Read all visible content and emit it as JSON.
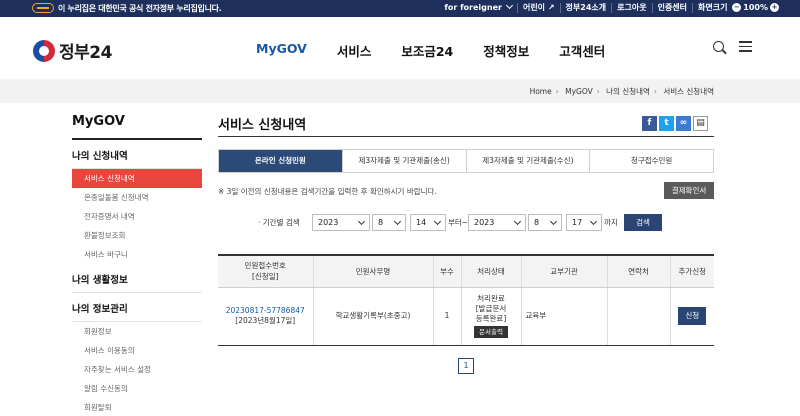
{
  "govbar": {
    "notice": "이 누리집은 대한민국 공식 전자정부 누리집입니다.",
    "links": [
      "for foreigner",
      "어린이",
      "정부24소개",
      "로그아웃",
      "인증센터",
      "화면크기"
    ],
    "zoom": "100%"
  },
  "header": {
    "logo": "정부24",
    "nav": [
      "MyGOV",
      "서비스",
      "보조금24",
      "정책정보",
      "고객센터"
    ]
  },
  "breadcrumb": [
    "Home",
    "MyGOV",
    "나의 신청내역",
    "서비스 신청내역"
  ],
  "sidebar": {
    "title": "MyGOV",
    "sections": [
      {
        "label": "나의 신청내역",
        "items": [
          "서비스 신청내역",
          "온종일돌봄 신청내역",
          "전자증명서 내역",
          "환불정보조회",
          "서비스 바구니"
        ]
      },
      {
        "label": "나의 생활정보",
        "items": []
      },
      {
        "label": "나의 정보관리",
        "items": [
          "회원정보",
          "서비스 이용동의",
          "자주찾는 서비스 설정",
          "알림 수신동의",
          "회원탈퇴"
        ]
      }
    ]
  },
  "main": {
    "title": "서비스 신청내역",
    "tabs": [
      "온라인 신청민원",
      "제3자제출 및 기관제출(송신)",
      "제3자제출 및 기관제출(수신)",
      "청구접수민원"
    ],
    "note": "※ 3일 이전의 신청내용은 검색기간을 입력한 후 확인하시기 바랍니다.",
    "payment_button": "결제확인서",
    "period": {
      "label": "· 기간별 검색",
      "from": {
        "year": "2023",
        "month": "8",
        "day": "14"
      },
      "to": {
        "year": "2023",
        "month": "8",
        "day": "17"
      },
      "from_text": "부터~",
      "to_text": "까지",
      "search_button": "검색"
    },
    "table": {
      "headers": [
        "민원접수번호\n[신청일]",
        "민원사무명",
        "부수",
        "처리상태",
        "교부기관",
        "연락처",
        "추가신청"
      ],
      "rows": [
        {
          "receipt_no": "20230817-57786847",
          "date": "[2023년8월17일]",
          "name": "학교생활기록부(초중고)",
          "copies": "1",
          "status": "처리완료\n[발급문서\n등록완료]",
          "status_button": "문서출력",
          "agency": "교육부",
          "contact": "",
          "apply_button": "신청"
        }
      ]
    },
    "pager": [
      "1"
    ]
  }
}
